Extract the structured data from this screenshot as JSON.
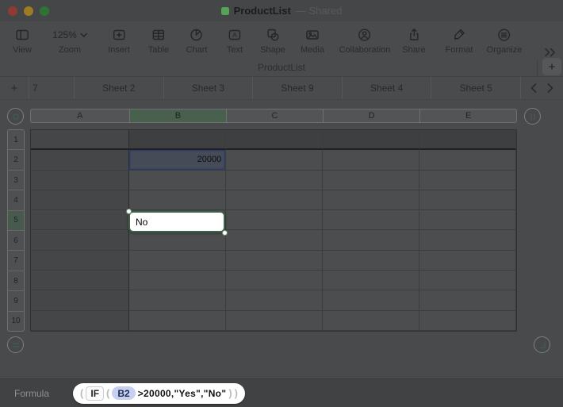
{
  "window": {
    "title": "ProductList",
    "shared_suffix": "—  Shared",
    "subtitle": "ProductList",
    "add_table_label": "+"
  },
  "toolbar": {
    "items": [
      {
        "label": "View"
      },
      {
        "label": "Zoom",
        "value": "125%"
      },
      {
        "label": "Insert"
      },
      {
        "label": "Table"
      },
      {
        "label": "Chart"
      },
      {
        "label": "Text"
      },
      {
        "label": "Shape"
      },
      {
        "label": "Media"
      },
      {
        "label": "Collaboration"
      },
      {
        "label": "Share"
      },
      {
        "label": "Format"
      },
      {
        "label": "Organize"
      }
    ]
  },
  "sheet_tabs": {
    "add_label": "+",
    "tabs": [
      "7",
      "Sheet 2",
      "Sheet 3",
      "Sheet 9",
      "Sheet 4",
      "Sheet 5"
    ]
  },
  "spreadsheet": {
    "columns": [
      "A",
      "B",
      "C",
      "D",
      "E"
    ],
    "selected_column": "B",
    "rows": [
      "1",
      "2",
      "3",
      "4",
      "5",
      "6",
      "7",
      "8",
      "9",
      "10"
    ],
    "selected_row": "5",
    "cells": {
      "B2": "20000"
    },
    "highlighted_cell": "B2",
    "editing_cell": {
      "ref": "B5",
      "value": "No"
    }
  },
  "formula_bar": {
    "label": "Formula",
    "tokens": [
      {
        "type": "paren",
        "value": "("
      },
      {
        "type": "func",
        "value": "IF"
      },
      {
        "type": "paren",
        "value": "("
      },
      {
        "type": "ref",
        "value": "B2"
      },
      {
        "type": "text",
        "value": ">20000,\"Yes\",\"No\""
      },
      {
        "type": "paren",
        "value": ")"
      },
      {
        "type": "paren",
        "value": ")"
      }
    ]
  },
  "colors": {
    "traffic_red": "#8f3a35",
    "traffic_yellow": "#9d7c22",
    "traffic_green": "#2f7435",
    "doc_icon_green": "#55a356",
    "selection_green": "#49604f",
    "selection_blue_border": "#2e3d68",
    "ref_token_bg": "#c7d0f0",
    "edit_border_green": "#3c6247"
  }
}
